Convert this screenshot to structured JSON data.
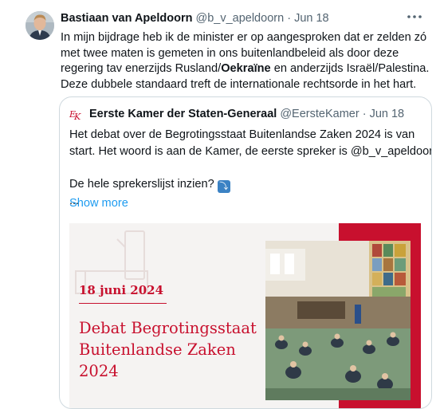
{
  "tweet": {
    "name": "Bastiaan van Apeldoorn",
    "handle": "@b_v_apeldoorn",
    "separator": "·",
    "date": "Jun 18",
    "more_icon": "more-horizontal-icon",
    "text_part1": "In mijn bijdrage heb ik de minister er op aangesproken dat er zelden zó met twee maten is gemeten in ons buitenlandbeleid als door deze regering tav enerzijds Rusland/",
    "text_bold": "Oekraïne",
    "text_part2": " en anderzijds Israël/Palestina. Deze dubbele standaard treft de internationale rechtsorde in het hart."
  },
  "quote": {
    "logo_icon": "eerste-kamer-logo",
    "name": "Eerste Kamer der Staten-Generaal",
    "handle": "@EersteKamer",
    "separator": "·",
    "date": "Jun 18",
    "line1": "Het debat over de Begrotingsstaat Buitenlandse Zaken 2024 is van",
    "line2": "start. Het woord is aan de Kamer, de eerste spreker is @b_v_apeldoorn.",
    "line3": "De hele sprekerslijst inzien?",
    "arrow_icon": "arrow-down-right-icon",
    "ellipsis": "...",
    "show_more": "Show more"
  },
  "media": {
    "date": "18 juni 2024",
    "title_line1": "Debat Begrotingsstaat",
    "title_line2": "Buitenlandse Zaken",
    "title_line3": "2024",
    "accent_color": "#c8102e"
  }
}
